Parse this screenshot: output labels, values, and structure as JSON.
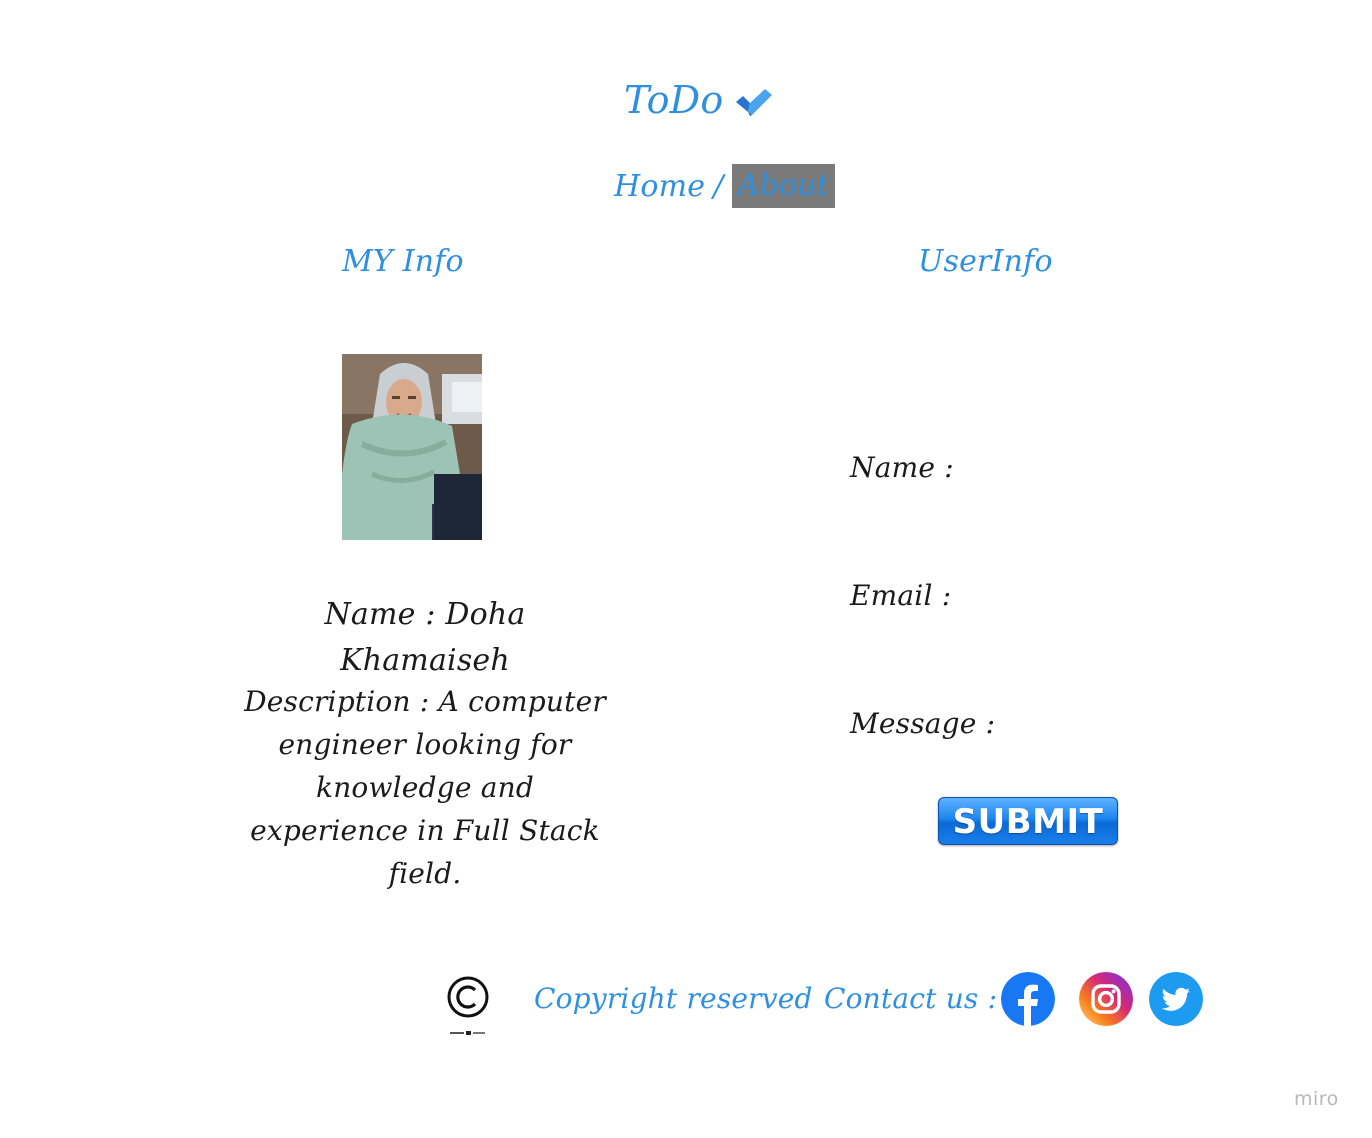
{
  "header": {
    "logo_text": "ToDo",
    "nav": {
      "home": "Home",
      "separator": "/",
      "about": "About"
    }
  },
  "my_info": {
    "title": "MY Info",
    "name_line": "Name : Doha Khamaiseh",
    "description_line": "Description : A computer engineer looking for knowledge and experience in Full Stack field."
  },
  "user_info": {
    "title": "UserInfo",
    "name_label": "Name :",
    "email_label": "Email :",
    "message_label": "Message  :",
    "submit_label": "SUBMIT"
  },
  "footer": {
    "copyright_text": "Copyright reserved",
    "contact_label": "Contact us :"
  },
  "watermark": "miro",
  "colors": {
    "accent": "#2f8fe0",
    "nav_highlight": "#7a7a7a",
    "text": "#1b1b1b",
    "submit": "#1c86f0"
  },
  "icons": {
    "logo": "check-icon",
    "copyright": "copyright-icon",
    "facebook": "facebook-icon",
    "instagram": "instagram-icon",
    "twitter": "twitter-icon"
  }
}
